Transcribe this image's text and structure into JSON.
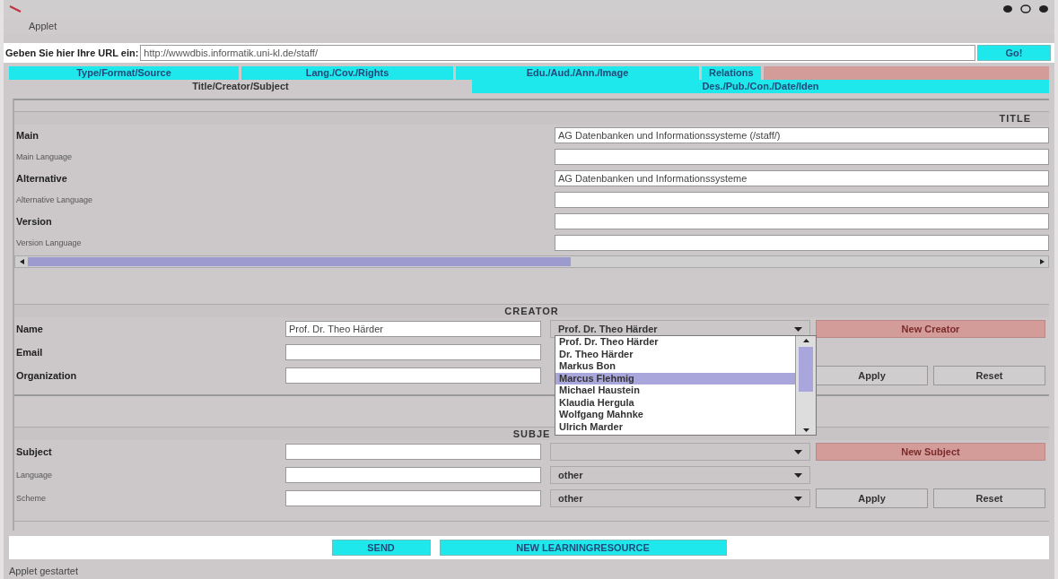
{
  "window": {
    "menu": "Applet"
  },
  "url_bar": {
    "label": "Geben Sie hier Ihre URL ein:",
    "value": "http://wwwdbis.informatik.uni-kl.de/staff/",
    "button": "Go!"
  },
  "tab_rows": [
    {
      "tabs": [
        {
          "label": "Type/Format/Source",
          "selected": false
        },
        {
          "label": "Lang./Cov./Rights",
          "selected": false
        },
        {
          "label": "Edu./Aud./Ann./Image",
          "selected": false
        },
        {
          "label": "Relations",
          "selected": false
        }
      ]
    },
    {
      "tabs": [
        {
          "label": "Title/Creator/Subject",
          "selected": true
        },
        {
          "label": "Des./Pub./Con./Date/Iden",
          "selected": false
        }
      ]
    }
  ],
  "title_section": {
    "heading": "TITLE",
    "rows": [
      {
        "label": "Main",
        "kind": "main",
        "value": "AG Datenbanken und Informationssysteme (/staff/)"
      },
      {
        "label": "Main Language",
        "kind": "language"
      },
      {
        "label": "Alternative",
        "kind": "main",
        "value": "AG Datenbanken und Informationssysteme"
      },
      {
        "label": "Alternative Language",
        "kind": "language"
      },
      {
        "label": "Version",
        "kind": "main"
      },
      {
        "label": "Version Language",
        "kind": "language"
      }
    ]
  },
  "creator_section": {
    "heading": "CREATOR",
    "rows": [
      {
        "label": "Name",
        "kind": "main",
        "value": "Prof. Dr. Theo Härder"
      },
      {
        "label": "Email",
        "kind": "main"
      },
      {
        "label": "Organization",
        "kind": "main"
      }
    ],
    "combo": "Prof. Dr. Theo Härder",
    "new_button": "New Creator",
    "buttons": [
      "Apply",
      "Reset"
    ],
    "dropdown": [
      {
        "label": "Prof. Dr. Theo Härder",
        "selected": false
      },
      {
        "label": "Dr. Theo Härder",
        "selected": false
      },
      {
        "label": "Markus Bon",
        "selected": false
      },
      {
        "label": "Marcus Flehmig",
        "selected": true
      },
      {
        "label": "Michael Haustein",
        "selected": false
      },
      {
        "label": "Klaudia Hergula",
        "selected": false
      },
      {
        "label": "Wolfgang Mahnke",
        "selected": false
      },
      {
        "label": "Ulrich Marder",
        "selected": false
      }
    ]
  },
  "subject_section": {
    "heading": "SUBJE",
    "rows": [
      {
        "label": "Subject",
        "kind": "main"
      },
      {
        "label": "Language",
        "kind": "language",
        "combo": "other"
      },
      {
        "label": "Scheme",
        "kind": "language",
        "combo": "other"
      }
    ],
    "new_button": "New Subject",
    "buttons": [
      "Apply",
      "Reset"
    ]
  },
  "actions": [
    "SEND",
    "NEW LEARNINGRESOURCE"
  ],
  "status_bar": "Applet gestartet"
}
